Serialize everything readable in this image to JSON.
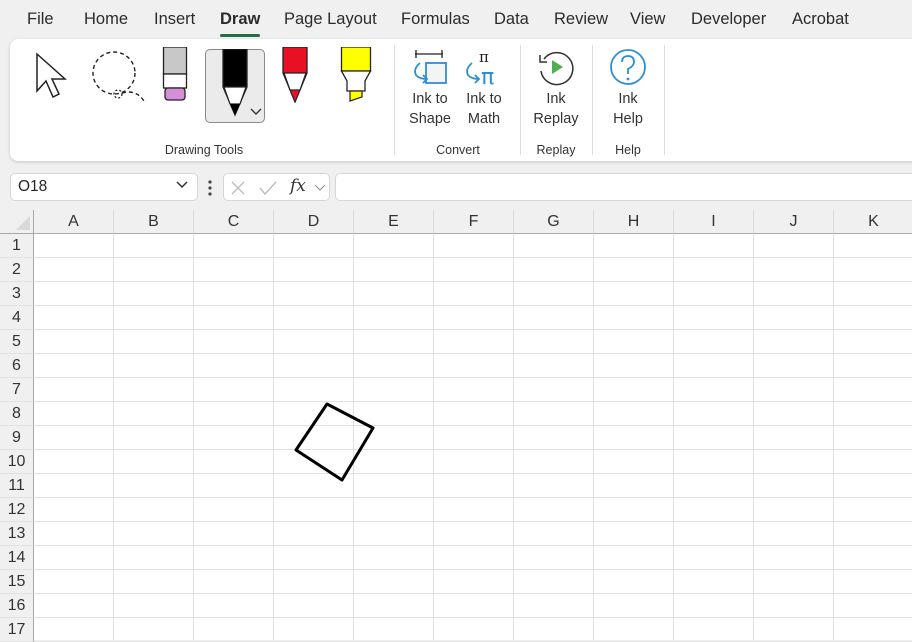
{
  "menu": {
    "tabs": [
      {
        "label": "File"
      },
      {
        "label": "Home"
      },
      {
        "label": "Insert"
      },
      {
        "label": "Draw",
        "active": true
      },
      {
        "label": "Page Layout"
      },
      {
        "label": "Formulas"
      },
      {
        "label": "Data"
      },
      {
        "label": "Review"
      },
      {
        "label": "View"
      },
      {
        "label": "Developer"
      },
      {
        "label": "Acrobat"
      }
    ]
  },
  "ribbon": {
    "groups": {
      "drawing_tools": {
        "label": "Drawing Tools",
        "tools": [
          {
            "name": "select",
            "icon": "cursor-arrow-icon"
          },
          {
            "name": "lasso-select",
            "icon": "lasso-icon"
          },
          {
            "name": "eraser",
            "icon": "eraser-icon",
            "color": "#d48fd6"
          },
          {
            "name": "pen-black",
            "icon": "pen-icon",
            "color": "#000000",
            "selected": true
          },
          {
            "name": "pen-red",
            "icon": "pen-icon",
            "color": "#e81123"
          },
          {
            "name": "highlighter-yellow",
            "icon": "highlighter-icon",
            "color": "#ffff00"
          }
        ]
      },
      "convert": {
        "label": "Convert",
        "ink_to_shape": {
          "line1": "Ink to",
          "line2": "Shape"
        },
        "ink_to_math": {
          "line1": "Ink to",
          "line2": "Math"
        }
      },
      "replay": {
        "label": "Replay",
        "ink_replay": {
          "line1": "Ink",
          "line2": "Replay"
        }
      },
      "help": {
        "label": "Help",
        "ink_help": {
          "line1": "Ink",
          "line2": "Help"
        }
      }
    },
    "accent_color": "#1e7145",
    "icon_blue": "#2b8fd6",
    "icon_green": "#4caf50"
  },
  "formula_bar": {
    "name_box": "O18",
    "fx_label": "fx",
    "formula_value": ""
  },
  "sheet": {
    "columns": [
      "A",
      "B",
      "C",
      "D",
      "E",
      "F",
      "G",
      "H",
      "I",
      "J",
      "K"
    ],
    "rows": [
      "1",
      "2",
      "3",
      "4",
      "5",
      "6",
      "7",
      "8",
      "9",
      "10",
      "11",
      "12",
      "13",
      "14",
      "15",
      "16",
      "17"
    ],
    "ink_drawing": {
      "shape": "rotated-square",
      "anchor_cells": "D8:E11"
    }
  }
}
